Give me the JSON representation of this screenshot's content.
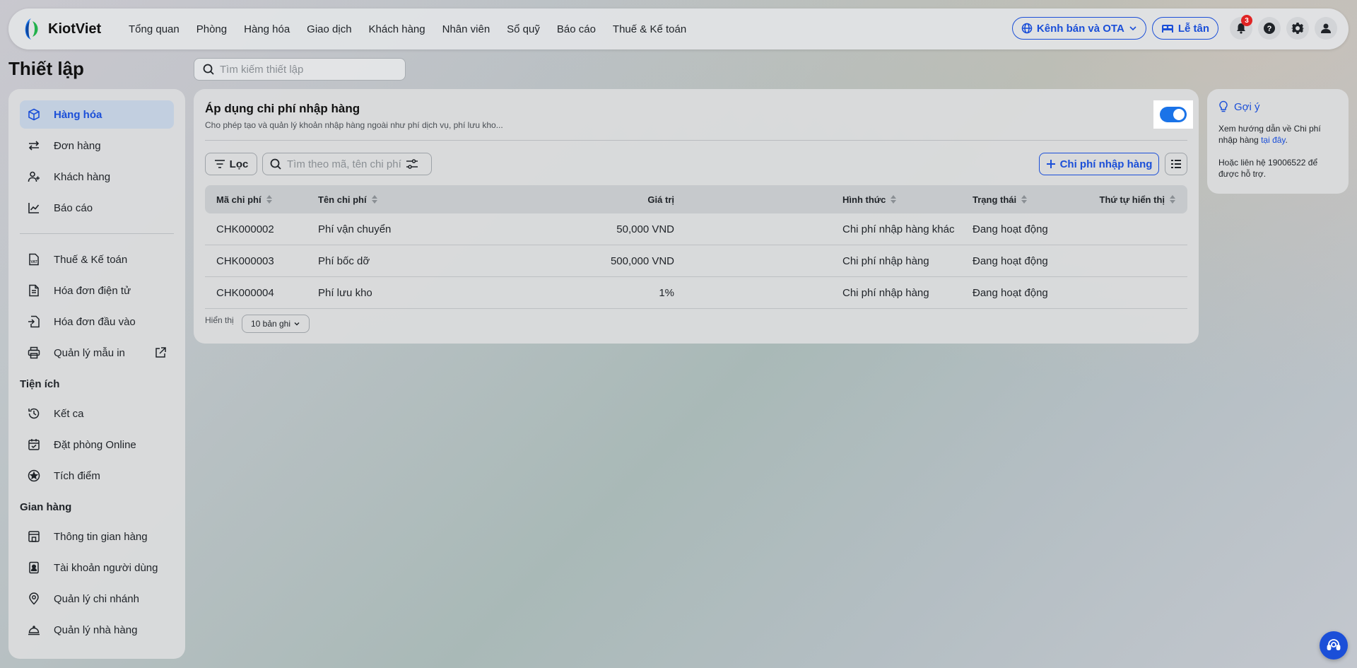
{
  "brand": {
    "name": "KiotViet"
  },
  "nav": {
    "items": [
      "Tổng quan",
      "Phòng",
      "Hàng hóa",
      "Giao dịch",
      "Khách hàng",
      "Nhân viên",
      "Sổ quỹ",
      "Báo cáo",
      "Thuế & Kế toán"
    ]
  },
  "topright": {
    "channels_label": "Kênh bán và OTA",
    "reception_label": "Lễ tân",
    "notification_count": "3"
  },
  "page": {
    "title": "Thiết lập",
    "search_placeholder": "Tìm kiếm thiết lập"
  },
  "sidebar": {
    "main_items": [
      {
        "label": "Hàng hóa",
        "icon": "box-icon",
        "active": true
      },
      {
        "label": "Đơn hàng",
        "icon": "swap-icon"
      },
      {
        "label": "Khách hàng",
        "icon": "users-icon"
      },
      {
        "label": "Báo cáo",
        "icon": "chart-icon"
      }
    ],
    "tax_items": [
      {
        "label": "Thuế & Kế toán",
        "icon": "vat-icon"
      },
      {
        "label": "Hóa đơn điện tử",
        "icon": "document-icon"
      },
      {
        "label": "Hóa đơn đầu vào",
        "icon": "invoice-in-icon"
      },
      {
        "label": "Quản lý mẫu in",
        "icon": "printer-icon"
      }
    ],
    "utilities_title": "Tiện ích",
    "utilities": [
      {
        "label": "Kết ca",
        "icon": "history-icon"
      },
      {
        "label": "Đặt phòng Online",
        "icon": "calendar-icon"
      },
      {
        "label": "Tích điểm",
        "icon": "star-icon"
      }
    ],
    "store_title": "Gian hàng",
    "store": [
      {
        "label": "Thông tin gian hàng",
        "icon": "store-icon"
      },
      {
        "label": "Tài khoản người dùng",
        "icon": "user-card-icon"
      },
      {
        "label": "Quản lý chi nhánh",
        "icon": "location-icon"
      },
      {
        "label": "Quản lý nhà hàng",
        "icon": "cloche-icon"
      }
    ]
  },
  "card": {
    "title": "Áp dụng chi phí nhập hàng",
    "subtitle": "Cho phép tạo và quản lý khoản nhập hàng ngoài như phí dịch vụ, phí lưu kho...",
    "toggle_on": true,
    "filter_label": "Lọc",
    "search_placeholder": "Tìm theo mã, tên chi phí",
    "add_label": "Chi phí nhập hàng"
  },
  "table": {
    "columns": [
      "Mã chi phí",
      "Tên chi phí",
      "Giá trị",
      "Hình thức",
      "Trạng thái",
      "Thứ tự hiển thị"
    ],
    "rows": [
      [
        "CHK000002",
        "Phí vận chuyển",
        "50,000 VND",
        "Chi phí nhập hàng khác",
        "Đang hoạt động",
        ""
      ],
      [
        "CHK000003",
        "Phí bốc dỡ",
        "500,000 VND",
        "Chi phí nhập hàng",
        "Đang hoạt động",
        ""
      ],
      [
        "CHK000004",
        "Phí lưu kho",
        "1%",
        "Chi phí nhập hàng",
        "Đang hoạt động",
        ""
      ]
    ],
    "show_label": "Hiển thị",
    "page_size_label": "10 bản ghi"
  },
  "hint": {
    "title": "Gợi ý",
    "line1": "Xem hướng dẫn về Chi phí nhập hàng ",
    "link": "tại đây",
    "line1_end": ".",
    "line2": "Hoặc liên hệ 19006522 để được hỗ trợ."
  },
  "colors": {
    "accent": "#1b4fd8",
    "toggle": "#1a73e8",
    "badge": "#e02424"
  }
}
